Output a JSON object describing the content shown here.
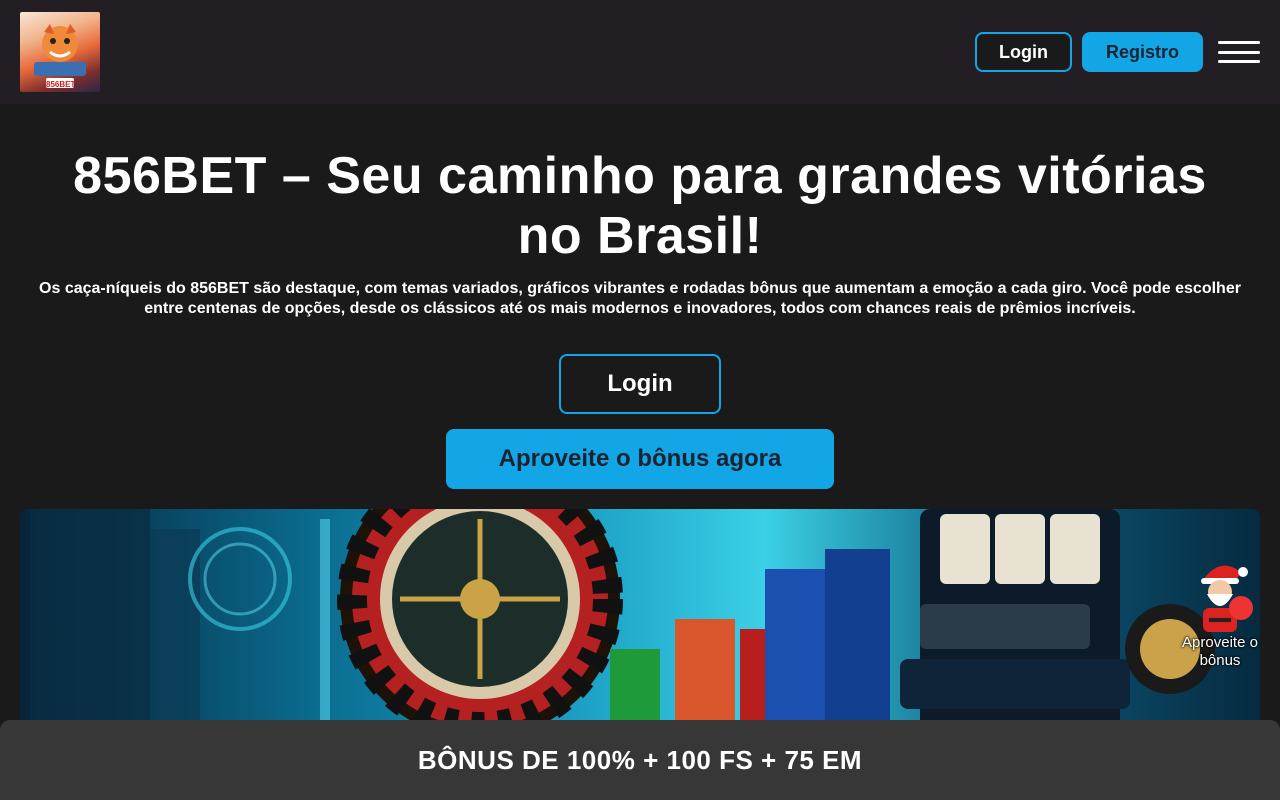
{
  "header": {
    "logo_text": "856BET",
    "login_label": "Login",
    "register_label": "Registro",
    "menu_icon": "hamburger-icon"
  },
  "hero": {
    "title": "856BET – Seu caminho para grandes vitórias no Brasil!",
    "description": "Os caça-níqueis do 856BET são destaque, com temas variados, gráficos vibrantes e rodadas bônus que aumentam a emoção a cada giro. Você pode escolher entre centenas de opções, desde os clássicos até os mais modernos e inovadores, todos com chances reais de prêmios incríveis.",
    "login_label": "Login",
    "bonus_label": "Aproveite o bônus agora"
  },
  "floating": {
    "label": "Aproveite o bônus",
    "icon": "santa-icon"
  },
  "bottom_bar": {
    "text": "BÔNUS DE 100% + 100 FS + 75 EM"
  },
  "colors": {
    "accent": "#12a6e6",
    "header_bg": "#221e24",
    "page_bg": "#1a1a1a",
    "bottom_bar_bg": "#373737"
  }
}
